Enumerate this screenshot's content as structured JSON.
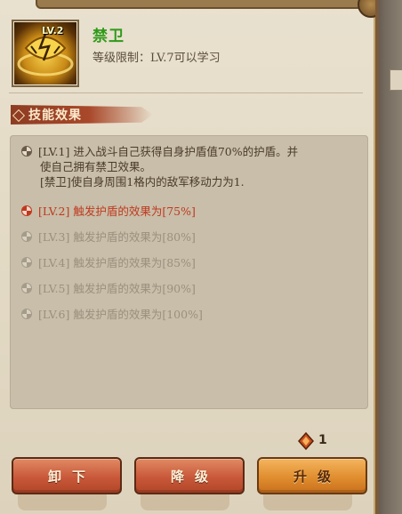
{
  "header": {
    "title_fragment": "",
    "skill_level_badge": "LV.2",
    "skill_name": "禁卫",
    "level_requirement": "等级限制：LV.7可以学习"
  },
  "section": {
    "title": "技能效果"
  },
  "effects": [
    {
      "level": "[LV.1]",
      "text": "进入战斗自己获得自身护盾值70%的护盾。并",
      "line2": "使自己拥有禁卫效果。",
      "line3": "[禁卫]使自身周围1格内的敌军移动力为1.",
      "state": "active"
    },
    {
      "level": "[LV.2]",
      "text": "触发护盾的效果为[75%]",
      "state": "current"
    },
    {
      "level": "[LV.3]",
      "text": "触发护盾的效果为[80%]",
      "state": "locked"
    },
    {
      "level": "[LV.4]",
      "text": "触发护盾的效果为[85%]",
      "state": "locked"
    },
    {
      "level": "[LV.5]",
      "text": "触发护盾的效果为[90%]",
      "state": "locked"
    },
    {
      "level": "[LV.6]",
      "text": "触发护盾的效果为[100%]",
      "state": "locked"
    }
  ],
  "cost": {
    "icon": "skill-book-icon",
    "amount": "1"
  },
  "buttons": {
    "unequip": "卸下",
    "downgrade": "降级",
    "upgrade": "升级"
  },
  "colors": {
    "skill_name": "#2f9a1a",
    "current_level": "#c0391f",
    "locked_level": "#9a907e"
  }
}
